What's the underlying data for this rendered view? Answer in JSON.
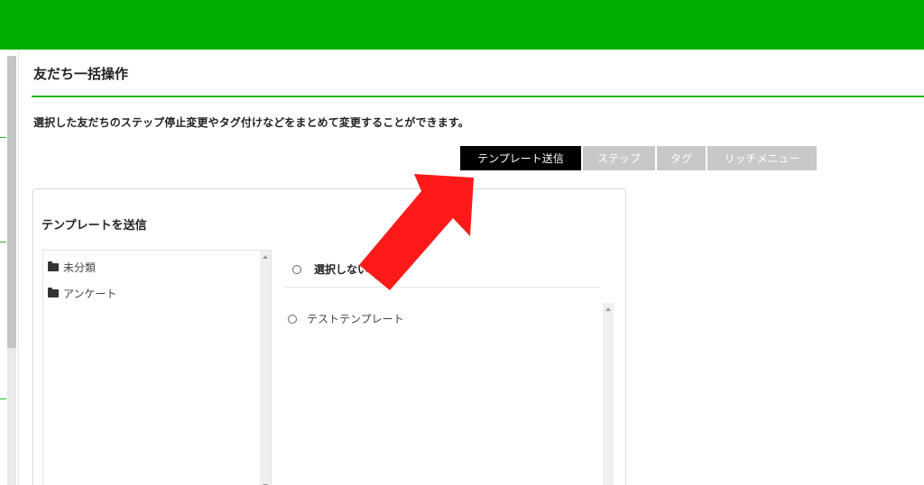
{
  "colors": {
    "header_green": "#00b000",
    "accent_rule": "#22b822",
    "tab_active_bg": "#000000",
    "tab_inactive_bg": "#c8c8c8",
    "annotation_arrow": "#ff1a1a"
  },
  "page": {
    "title": "友だち一括操作",
    "description": "選択した友だちのステップ停止変更やタグ付けなどをまとめて変更することができます。"
  },
  "tabs": [
    {
      "label": "テンプレート送信",
      "active": true
    },
    {
      "label": "ステップ",
      "active": false
    },
    {
      "label": "タグ",
      "active": false
    },
    {
      "label": "リッチメニュー",
      "active": false
    }
  ],
  "template_panel": {
    "title": "テンプレートを送信",
    "folders": [
      {
        "label": "未分類",
        "icon": "folder-icon"
      },
      {
        "label": "アンケート",
        "icon": "folder-icon"
      }
    ],
    "no_select_label": "選択しない",
    "templates": [
      {
        "label": "テストテンプレート"
      }
    ]
  },
  "annotation": {
    "type": "arrow",
    "points_to": "テンプレート送信"
  }
}
